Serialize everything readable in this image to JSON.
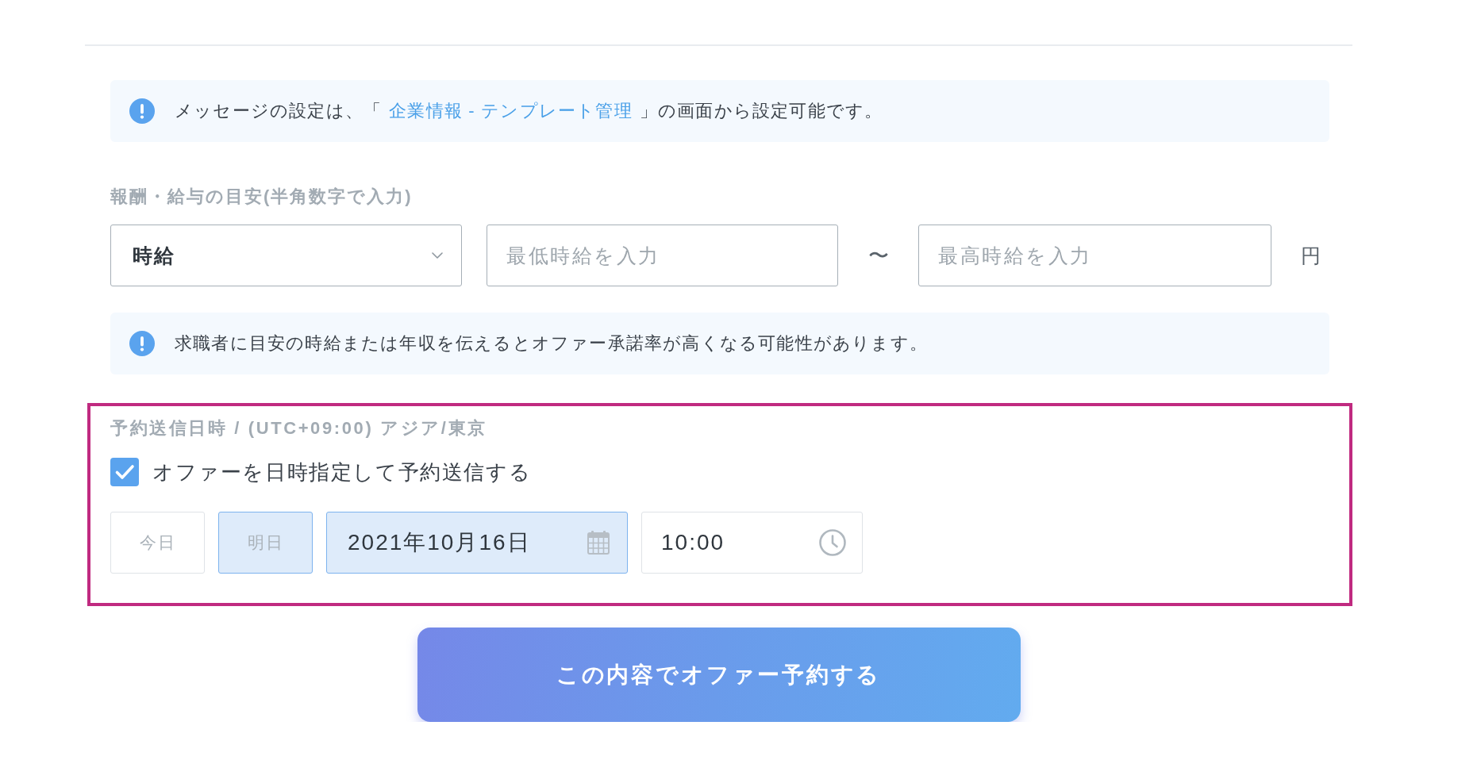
{
  "message_notice": {
    "parts": [
      {
        "kind": "text",
        "text": "メッセージの設定は、「"
      },
      {
        "kind": "link",
        "text": "企業情報 - テンプレート管理"
      },
      {
        "kind": "text",
        "text": "」の画面から設定可能です。"
      }
    ]
  },
  "salary": {
    "label": "報酬・給与の目安(半角数字で入力)",
    "unit_select": {
      "value": "時給"
    },
    "min_field": {
      "placeholder": "最低時給を入力"
    },
    "separator": "〜",
    "max_field": {
      "placeholder": "最高時給を入力"
    },
    "currency": "円"
  },
  "salary_notice": {
    "parts": [
      {
        "kind": "text",
        "text": "求職者に目安の時給または年収を伝えるとオファー承諾率が高くなる可能性があります。"
      }
    ]
  },
  "schedule": {
    "highlighted": true,
    "label": "予約送信日時 / (UTC+09:00) アジア/東京",
    "checkbox": {
      "label": "オファーを日時指定して予約送信する",
      "checked": true
    },
    "quick_days": [
      {
        "label": "今日",
        "selected": false
      },
      {
        "label": "明日",
        "selected": true
      }
    ],
    "date_field": {
      "value": "2021年10月16日",
      "active": true
    },
    "time_field": {
      "value": "10:00"
    }
  },
  "submit_button": {
    "label": "この内容でオファー予約する"
  }
}
